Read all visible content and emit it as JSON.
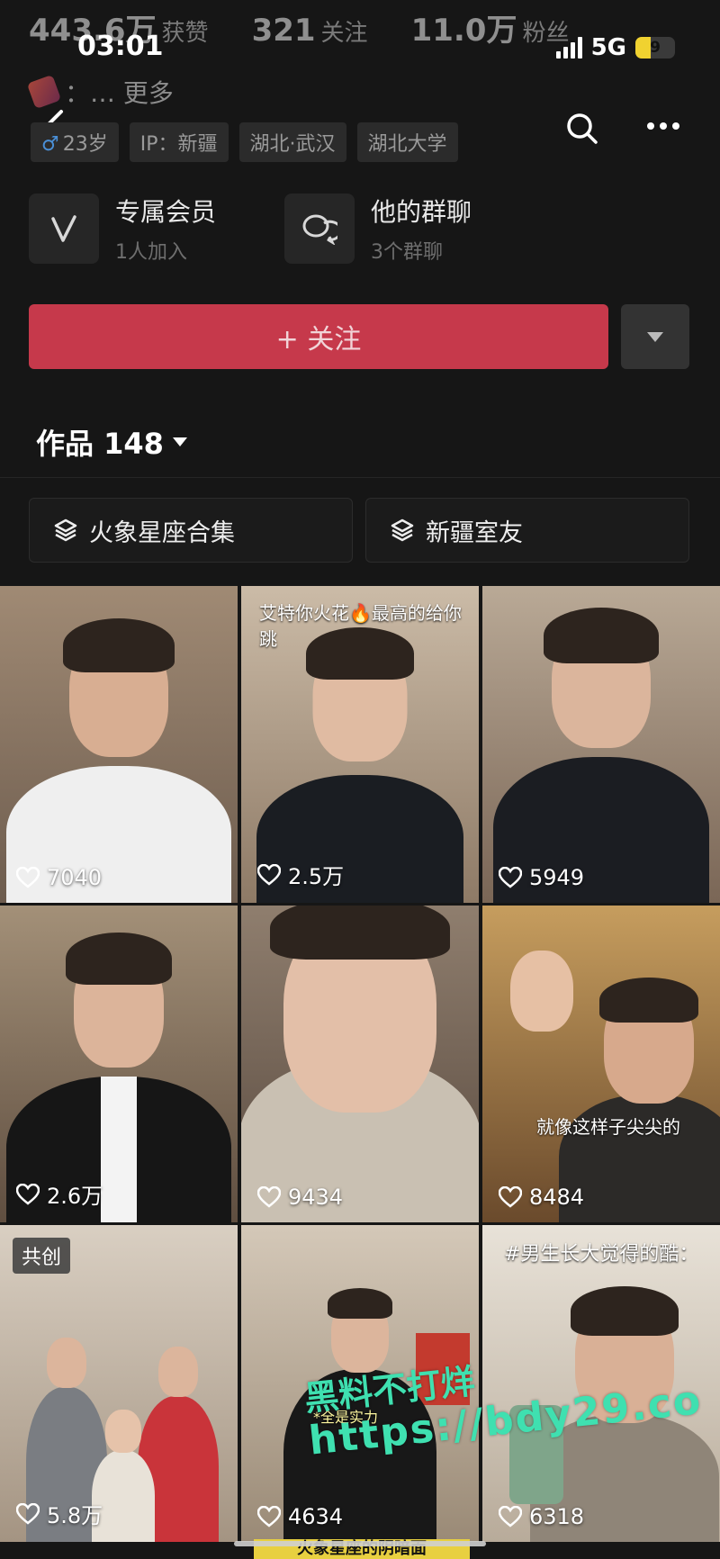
{
  "stats": {
    "likes_num": "443.6万",
    "likes_label": "获赞",
    "following_num": "321",
    "following_label": "关注",
    "fans_num": "11.0万",
    "fans_label": "粉丝"
  },
  "status_bar": {
    "time": "03:01",
    "network": "5G",
    "battery": "9",
    "battery_level": 0.38
  },
  "bio": {
    "text": "：… 更多"
  },
  "tags": [
    {
      "label": "23岁",
      "icon": "male-icon"
    },
    {
      "label": "IP：新疆"
    },
    {
      "label": "湖北·武汉"
    },
    {
      "label": "湖北大学"
    }
  ],
  "features": [
    {
      "title": "专属会员",
      "sub": "1人加入",
      "icon": "vip-v-icon"
    },
    {
      "title": "他的群聊",
      "sub": "3个群聊",
      "icon": "group-chat-icon"
    }
  ],
  "follow_button": {
    "label": "+ 关注",
    "color": "#c6394b"
  },
  "works": {
    "label": "作品 148"
  },
  "collections": [
    {
      "label": "火象星座合集",
      "icon": "collection-icon"
    },
    {
      "label": "新疆室友",
      "icon": "collection-icon"
    }
  ],
  "videos": [
    {
      "likes": "7040"
    },
    {
      "likes": "2.5万",
      "caption": "艾特你火花🔥最高的给你跳"
    },
    {
      "likes": "5949"
    },
    {
      "likes": "2.6万"
    },
    {
      "likes": "9434"
    },
    {
      "likes": "8484",
      "caption": "就像这样子尖尖的"
    },
    {
      "likes": "5.8万",
      "badge": "共创"
    },
    {
      "likes": "4634",
      "caption": "*全是实力"
    },
    {
      "likes": "6318",
      "caption": "#男生长大觉得的酷："
    }
  ],
  "watermark": {
    "line1": "黑料不打烊",
    "line2": "https://bdy29.co"
  },
  "bottom_caption": "火象星座的阴暗面"
}
